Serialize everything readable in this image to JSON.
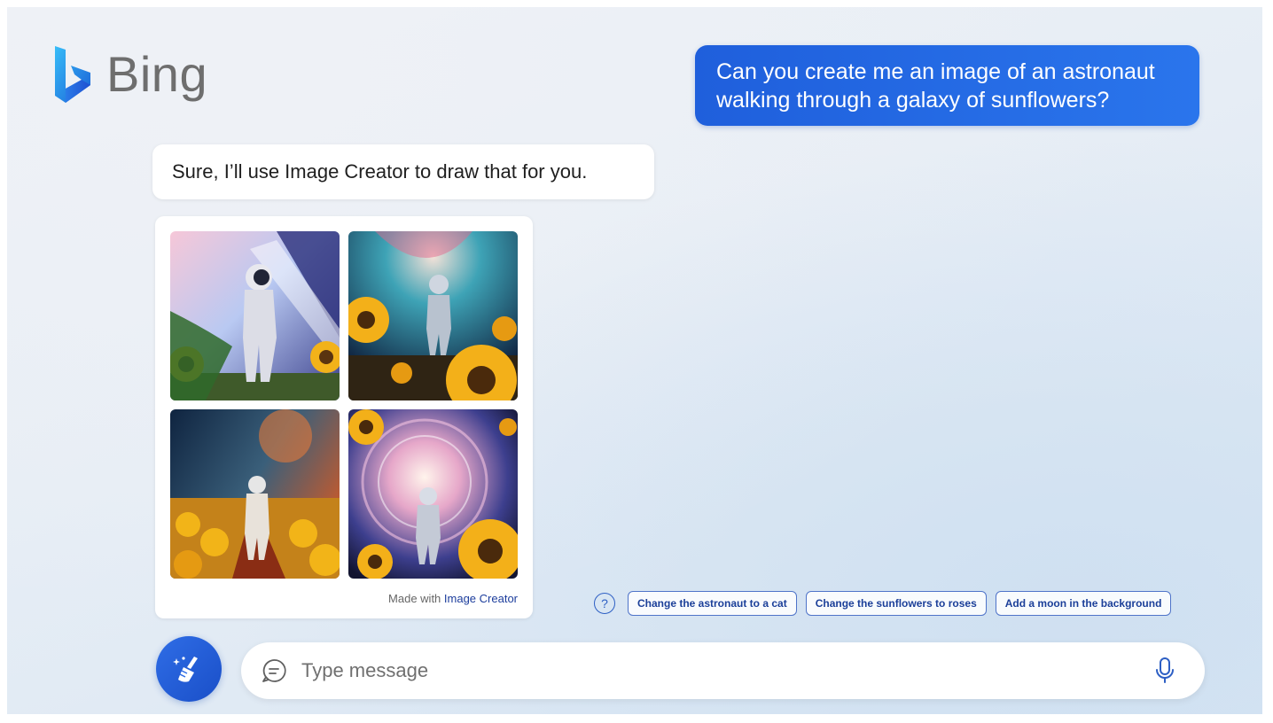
{
  "brand": {
    "name": "Bing",
    "accent": "#2a6be6"
  },
  "conversation": {
    "user_message": "Can you create me an image of an astronaut walking through a galaxy of sunflowers?",
    "assistant_message": "Sure, I’ll use Image Creator to draw that for you."
  },
  "image_card": {
    "images": [
      {
        "icon": "astronaut-sunflowers-image"
      },
      {
        "icon": "astronaut-sunflowers-image"
      },
      {
        "icon": "astronaut-sunflowers-image"
      },
      {
        "icon": "astronaut-sunflowers-image"
      }
    ],
    "caption_prefix": "Made with",
    "caption_link": "Image Creator"
  },
  "suggestions": {
    "help_icon": "help-icon",
    "help_glyph": "?",
    "items": [
      "Change the astronaut to a cat",
      "Change the sunflowers to roses",
      "Add a moon in the background"
    ]
  },
  "composer": {
    "new_topic_icon": "broom-icon",
    "chat_icon": "chat-bubble-icon",
    "placeholder": "Type message",
    "value": "",
    "mic_icon": "microphone-icon"
  }
}
